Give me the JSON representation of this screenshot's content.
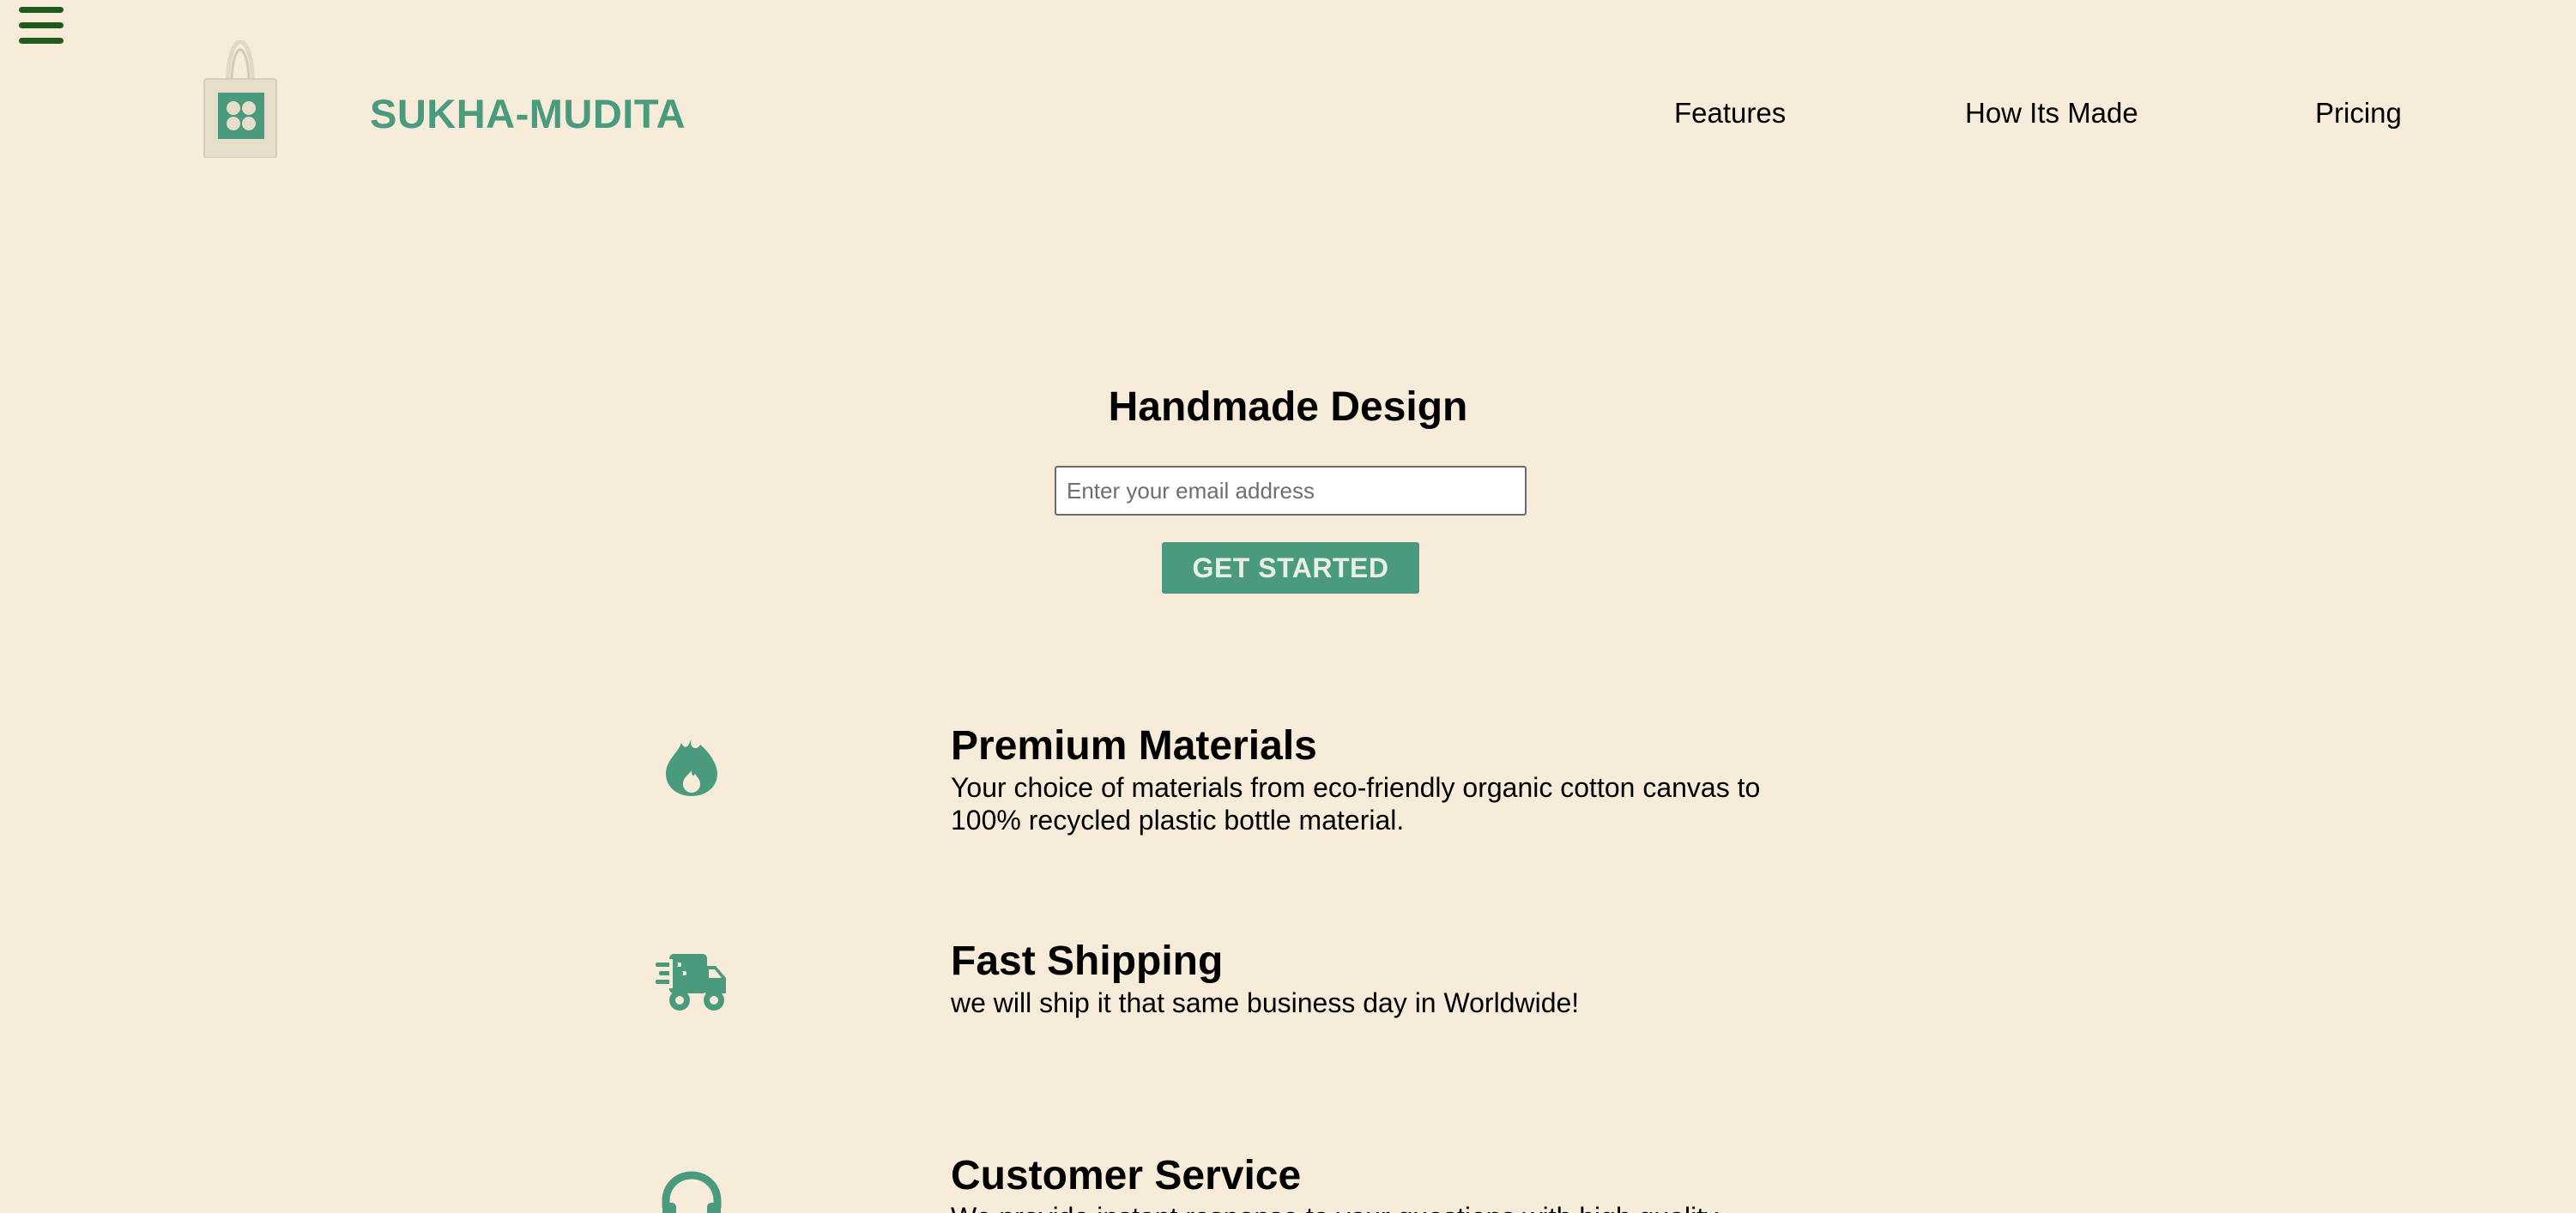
{
  "header": {
    "brand": "SUKHA-MUDITA",
    "menu_icon": "hamburger-menu-icon",
    "logo_icon": "tote-bag-logo",
    "nav": [
      {
        "label": "Features"
      },
      {
        "label": "How Its Made"
      },
      {
        "label": "Pricing"
      }
    ]
  },
  "hero": {
    "title": "Handmade Design",
    "email_placeholder": "Enter your email address",
    "email_value": "",
    "cta_label": "GET STARTED"
  },
  "features": [
    {
      "icon": "fire-icon",
      "title": "Premium Materials",
      "description": "Your choice of materials from eco-friendly organic cotton canvas to 100% recycled plastic bottle material."
    },
    {
      "icon": "shipping-truck-icon",
      "title": "Fast Shipping",
      "description": "we will ship it that same business day in Worldwide!"
    },
    {
      "icon": "headset-icon",
      "title": "Customer Service",
      "description": "We provide instant response to your questions with high quality"
    }
  ],
  "colors": {
    "background": "#f7ebda",
    "accent": "#4a9b7e",
    "menu_icon": "#1f5a1e",
    "button_text": "#e9efe6"
  }
}
